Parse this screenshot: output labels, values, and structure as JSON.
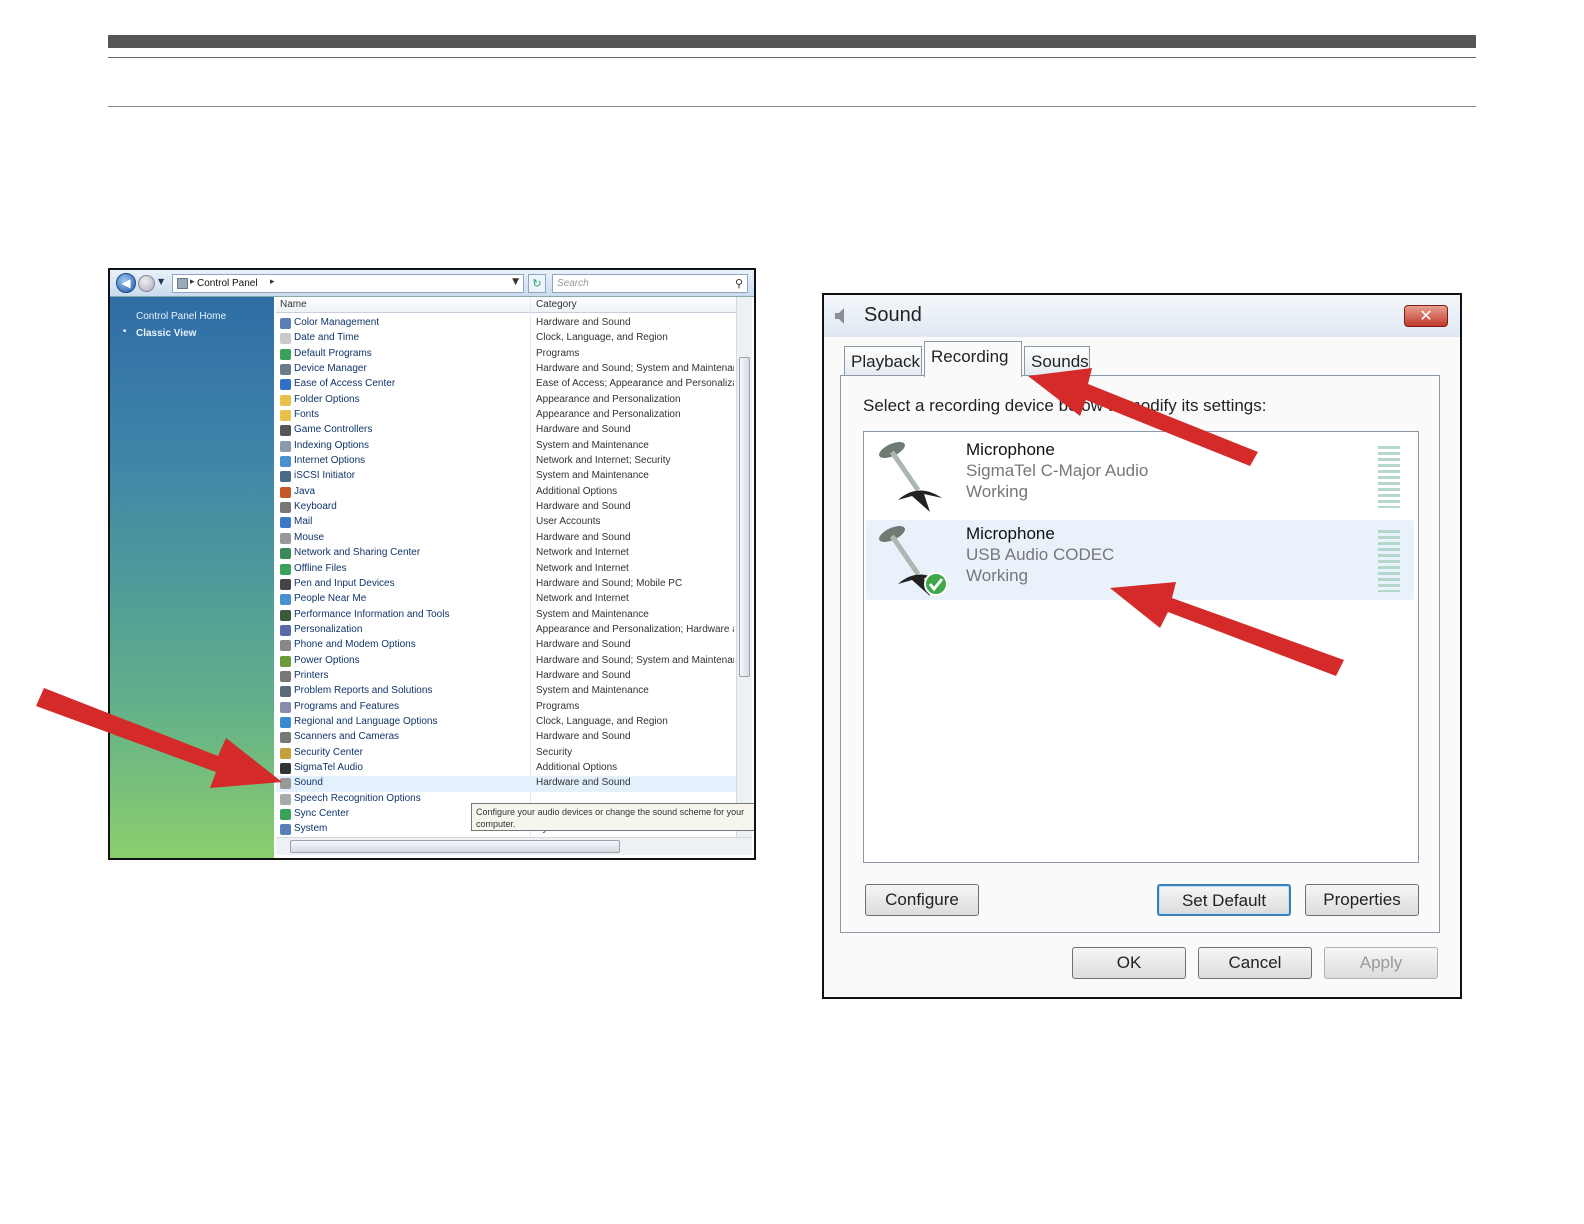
{
  "control_panel": {
    "breadcrumb": "Control Panel",
    "search_placeholder": "Search",
    "sidebar": {
      "home_link": "Control Panel Home",
      "classic_view": "Classic View"
    },
    "columns": {
      "name": "Name",
      "category": "Category"
    },
    "items": [
      {
        "name": "Color Management",
        "category": "Hardware and Sound",
        "color": "#5a7fb5"
      },
      {
        "name": "Date and Time",
        "category": "Clock, Language, and Region",
        "color": "#c9c9c9"
      },
      {
        "name": "Default Programs",
        "category": "Programs",
        "color": "#3aa35a"
      },
      {
        "name": "Device Manager",
        "category": "Hardware and Sound; System and Maintenance",
        "color": "#6b7a8a"
      },
      {
        "name": "Ease of Access Center",
        "category": "Ease of Access; Appearance and Personalization",
        "color": "#2f6fc4"
      },
      {
        "name": "Folder Options",
        "category": "Appearance and Personalization",
        "color": "#e8c14a"
      },
      {
        "name": "Fonts",
        "category": "Appearance and Personalization",
        "color": "#e8c14a"
      },
      {
        "name": "Game Controllers",
        "category": "Hardware and Sound",
        "color": "#555"
      },
      {
        "name": "Indexing Options",
        "category": "System and Maintenance",
        "color": "#8a9aaa"
      },
      {
        "name": "Internet Options",
        "category": "Network and Internet; Security",
        "color": "#4a8fd0"
      },
      {
        "name": "iSCSI Initiator",
        "category": "System and Maintenance",
        "color": "#4a6a8a"
      },
      {
        "name": "Java",
        "category": "Additional Options",
        "color": "#c45a2a"
      },
      {
        "name": "Keyboard",
        "category": "Hardware and Sound",
        "color": "#777"
      },
      {
        "name": "Mail",
        "category": "User Accounts",
        "color": "#3a7ac4"
      },
      {
        "name": "Mouse",
        "category": "Hardware and Sound",
        "color": "#999"
      },
      {
        "name": "Network and Sharing Center",
        "category": "Network and Internet",
        "color": "#3a8a5a"
      },
      {
        "name": "Offline Files",
        "category": "Network and Internet",
        "color": "#3aa35a"
      },
      {
        "name": "Pen and Input Devices",
        "category": "Hardware and Sound; Mobile PC",
        "color": "#444"
      },
      {
        "name": "People Near Me",
        "category": "Network and Internet",
        "color": "#4a8fd0"
      },
      {
        "name": "Performance Information and Tools",
        "category": "System and Maintenance",
        "color": "#3a5a3a"
      },
      {
        "name": "Personalization",
        "category": "Appearance and Personalization; Hardware and Sound",
        "color": "#5a6aaa"
      },
      {
        "name": "Phone and Modem Options",
        "category": "Hardware and Sound",
        "color": "#888"
      },
      {
        "name": "Power Options",
        "category": "Hardware and Sound; System and Maintenance",
        "color": "#6a9a3a"
      },
      {
        "name": "Printers",
        "category": "Hardware and Sound",
        "color": "#777"
      },
      {
        "name": "Problem Reports and Solutions",
        "category": "System and Maintenance",
        "color": "#5a6a7a"
      },
      {
        "name": "Programs and Features",
        "category": "Programs",
        "color": "#8a8aaa"
      },
      {
        "name": "Regional and Language Options",
        "category": "Clock, Language, and Region",
        "color": "#3a8ad0"
      },
      {
        "name": "Scanners and Cameras",
        "category": "Hardware and Sound",
        "color": "#777"
      },
      {
        "name": "Security Center",
        "category": "Security",
        "color": "#c4a03a"
      },
      {
        "name": "SigmaTel Audio",
        "category": "Additional Options",
        "color": "#333"
      },
      {
        "name": "Sound",
        "category": "Hardware and Sound",
        "color": "#999",
        "selected": true
      },
      {
        "name": "Speech Recognition Options",
        "category": "",
        "color": "#aaa"
      },
      {
        "name": "Sync Center",
        "category": "",
        "color": "#3aa35a"
      },
      {
        "name": "System",
        "category": "System and Maintenance",
        "color": "#5a7fb5"
      }
    ],
    "tooltip": "Configure your audio devices or change the sound scheme for your computer."
  },
  "sound_dialog": {
    "title": "Sound",
    "tabs": [
      "Playback",
      "Recording",
      "Sounds"
    ],
    "active_tab": "Recording",
    "instruction": "Select a recording device below to modify its settings:",
    "devices": [
      {
        "name": "Microphone",
        "driver": "SigmaTel C-Major Audio",
        "status": "Working",
        "default": false
      },
      {
        "name": "Microphone",
        "driver": "USB Audio CODEC",
        "status": "Working",
        "default": true
      }
    ],
    "buttons": {
      "configure": "Configure",
      "set_default": "Set Default",
      "properties": "Properties",
      "ok": "OK",
      "cancel": "Cancel",
      "apply": "Apply"
    }
  },
  "colors": {
    "arrow": "#d42a2a",
    "sidebar_top": "#2f6da6",
    "sidebar_bottom": "#8ccf6c"
  }
}
